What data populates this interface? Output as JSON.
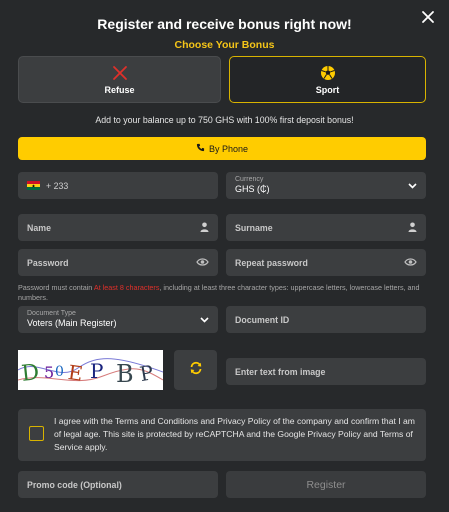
{
  "header": {
    "title": "Register and receive bonus right now!",
    "subtitle": "Choose Your Bonus"
  },
  "bonus_options": [
    {
      "label": "Refuse",
      "icon": "close-x-icon",
      "selected": false
    },
    {
      "label": "Sport",
      "icon": "soccer-ball-icon",
      "selected": true
    }
  ],
  "bonus_note": "Add to your balance up to 750 GHS with 100% first deposit bonus!",
  "method_button": {
    "label": "By Phone",
    "icon": "phone-icon"
  },
  "phone": {
    "country_flag": "ghana-flag-icon",
    "code": "+ 233"
  },
  "currency": {
    "label": "Currency",
    "value": "GHS (₵)"
  },
  "name": {
    "placeholder": "Name"
  },
  "surname": {
    "placeholder": "Surname"
  },
  "password": {
    "placeholder": "Password"
  },
  "repeat_password": {
    "placeholder": "Repeat password"
  },
  "password_hint": {
    "before": "Password must contain ",
    "highlight": "At least 8 characters",
    "after": ", including at least three character types: uppercase letters, lowercase letters, and numbers."
  },
  "document_type": {
    "label": "Document Type",
    "value": "Voters (Main Register)"
  },
  "document_id": {
    "placeholder": "Document ID"
  },
  "captcha": {
    "text": "D 50 E P B P",
    "input_placeholder": "Enter text from image"
  },
  "agreement": "I agree with the Terms and Conditions and Privacy Policy of the company and confirm that I am of legal age. This site is protected by reCAPTCHA and the Google Privacy Policy and Terms of Service apply.",
  "promo": {
    "placeholder": "Promo code (Optional)"
  },
  "register_label": "Register",
  "colors": {
    "accent": "#ffcc00",
    "background": "#27292b",
    "field": "#3c3e40",
    "error": "#e0302a"
  }
}
